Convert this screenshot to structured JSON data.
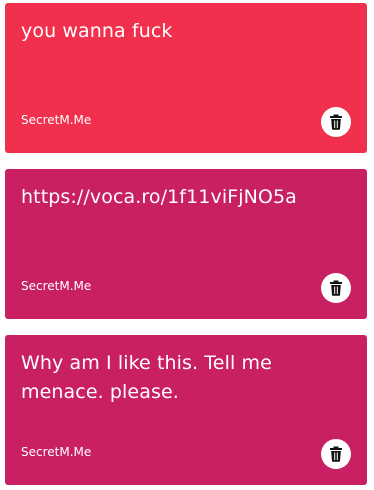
{
  "colors": {
    "card_red": "#f0304c",
    "card_magenta": "#c91f63",
    "icon_dark": "#111111"
  },
  "messages": [
    {
      "text": "you wanna fuck",
      "source": "SecretM.Me",
      "color": "#f0304c",
      "delete_icon": "trash-icon"
    },
    {
      "text": "https://voca.ro/1f11viFjNO5a",
      "source": "SecretM.Me",
      "color": "#c91f63",
      "delete_icon": "trash-icon"
    },
    {
      "text": "Why am I like this. Tell me menace. please.",
      "source": "SecretM.Me",
      "color": "#c91f63",
      "delete_icon": "trash-icon"
    }
  ]
}
